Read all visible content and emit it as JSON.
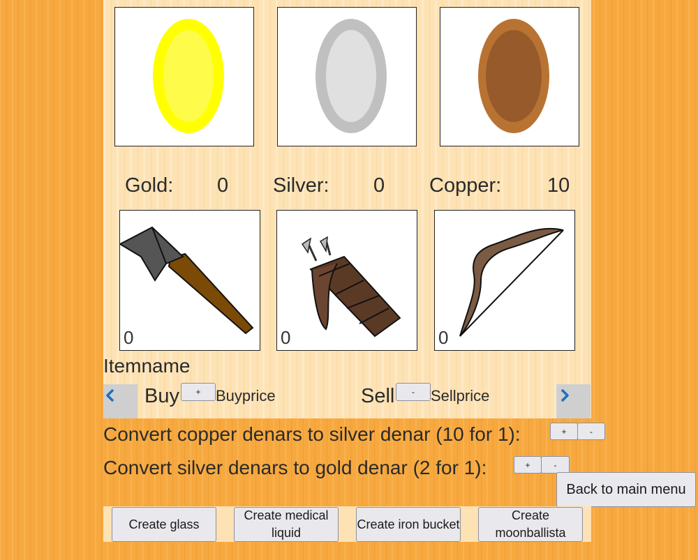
{
  "currencies": [
    {
      "label": "Gold:",
      "value": "0",
      "icon": "gold-coin-icon",
      "outer": "#ffff00",
      "inner": "#fffb4a"
    },
    {
      "label": "Silver:",
      "value": "0",
      "icon": "silver-coin-icon",
      "outer": "#c0c0c0",
      "inner": "#e0e0e0"
    },
    {
      "label": "Copper:",
      "value": "10",
      "icon": "copper-coin-icon",
      "outer": "#b87333",
      "inner": "#975a2a"
    }
  ],
  "items": [
    {
      "icon": "axe-icon",
      "count": "0"
    },
    {
      "icon": "quiver-icon",
      "count": "0"
    },
    {
      "icon": "bow-icon",
      "count": "0"
    }
  ],
  "shop": {
    "item_name": "Itemname",
    "buy_label": "Buy",
    "buy_button": "+",
    "buy_price": "Buyprice",
    "sell_label": "Sell",
    "sell_button": "-",
    "sell_price": "Sellprice",
    "prev_icon": "chevron-left-icon",
    "next_icon": "chevron-right-icon"
  },
  "convert": {
    "copper_to_silver": "Convert copper denars to silver denar (10 for 1):",
    "silver_to_gold": "Convert silver denars to gold denar (2 for 1):",
    "plus": "+",
    "minus": "-"
  },
  "back_button": "Back to main menu",
  "create_buttons": [
    "Create glass",
    "Create medical liquid",
    "Create iron bucket",
    "Create moonballista"
  ],
  "colors": {
    "background": "#f7a93f",
    "panel": "#fde2b4",
    "arrow": "#1a6fc4"
  }
}
